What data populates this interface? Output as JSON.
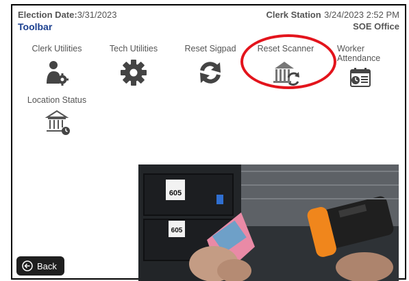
{
  "header": {
    "election_date_label": "Election Date:",
    "election_date_value": "3/31/2023",
    "station_label": "Clerk Station",
    "station_datetime": "3/24/2023 2:52 PM",
    "toolbar_title": "Toolbar",
    "office": "SOE Office"
  },
  "tiles": {
    "clerk_utilities": "Clerk Utilities",
    "tech_utilities": "Tech Utilities",
    "reset_sigpad": "Reset Sigpad",
    "reset_scanner": "Reset Scanner",
    "worker_attendance_1": "Worker",
    "worker_attendance_2": "Attendance",
    "location_status": "Location Status"
  },
  "back_button": "Back",
  "photo": {
    "bin_label_1": "605",
    "bin_label_2": "605"
  },
  "colors": {
    "accent": "#1a3f8f",
    "highlight": "#e3141c",
    "icon": "#444444"
  }
}
